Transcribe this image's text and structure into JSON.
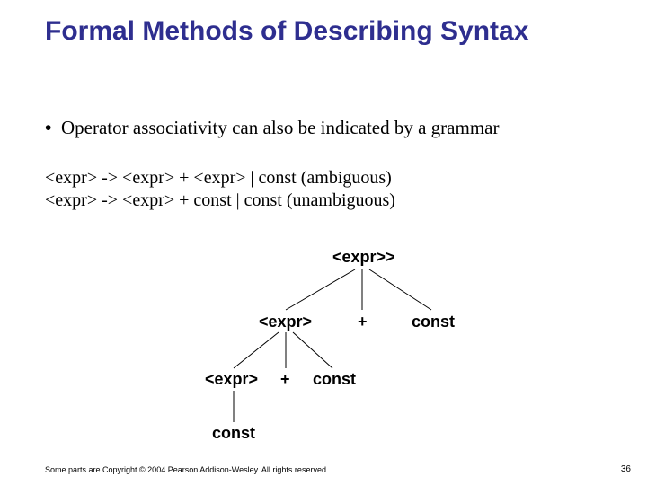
{
  "title": "Formal Methods of Describing Syntax",
  "bullet": "Operator associativity can also be indicated by a grammar",
  "grammar": {
    "line1": "<expr> -> <expr> + <expr>  |  const  (ambiguous)",
    "line2": "<expr> -> <expr> + const  |  const  (unambiguous)"
  },
  "tree": {
    "root": "<expr>",
    "root_trailing_angle": ">",
    "l1_left": "<expr>",
    "l1_plus": "+",
    "l1_right": "const",
    "l2_left": "<expr>",
    "l2_plus": "+",
    "l2_right": "const",
    "l3_left": "const"
  },
  "footer": {
    "copyright": "Some parts are Copyright © 2004 Pearson Addison-Wesley. All rights reserved.",
    "page": "36"
  }
}
